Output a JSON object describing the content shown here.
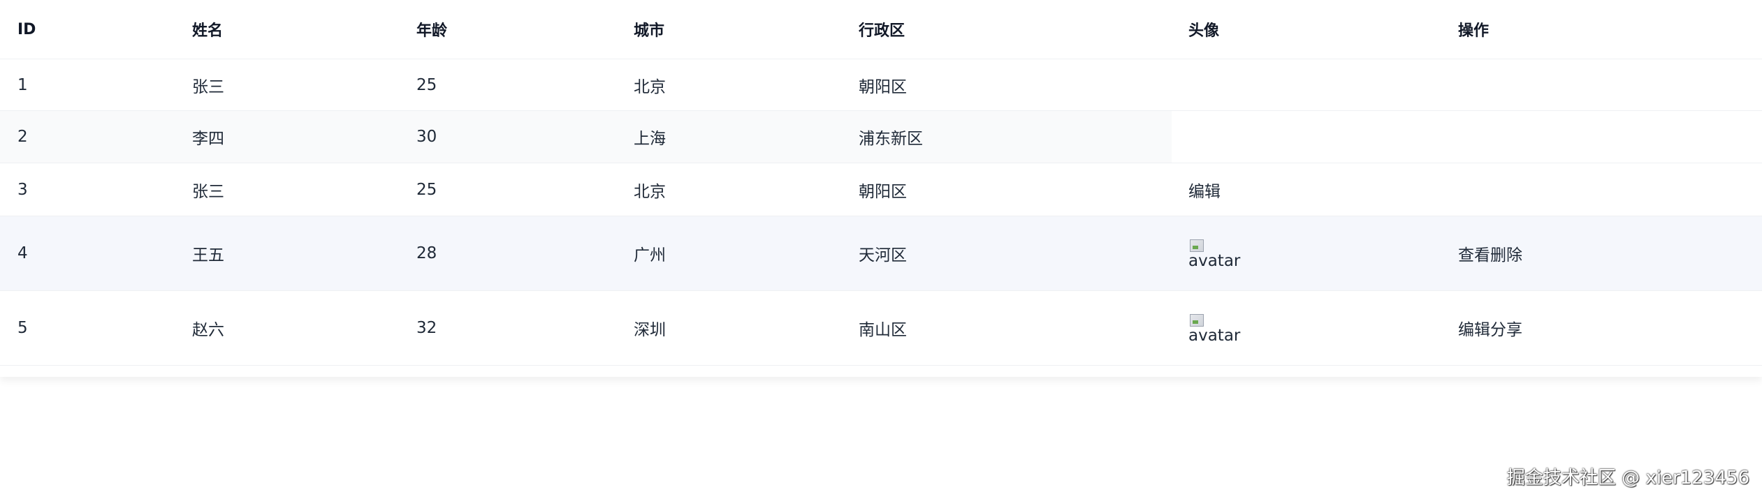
{
  "table": {
    "headers": [
      "ID",
      "姓名",
      "年龄",
      "城市",
      "行政区",
      "头像",
      "操作"
    ],
    "rows": [
      {
        "id": "1",
        "name": "张三",
        "age": "25",
        "city": "北京",
        "district": "朝阳区",
        "avatar": "",
        "actions": ""
      },
      {
        "id": "2",
        "name": "李四",
        "age": "30",
        "city": "上海",
        "district": "浦东新区",
        "avatar": "",
        "actions": ""
      },
      {
        "id": "3",
        "name": "张三",
        "age": "25",
        "city": "北京",
        "district": "朝阳区",
        "avatar": "编辑",
        "actions": ""
      },
      {
        "id": "4",
        "name": "王五",
        "age": "28",
        "city": "广州",
        "district": "天河区",
        "avatar_alt": "avatar",
        "actions": "查看删除"
      },
      {
        "id": "5",
        "name": "赵六",
        "age": "32",
        "city": "深圳",
        "district": "南山区",
        "avatar_alt": "avatar",
        "actions": "编辑分享"
      }
    ]
  },
  "watermark": "掘金技术社区 @ xier123456",
  "colors": {
    "header_text": "#111827",
    "row_text": "#1f2937",
    "stripe": "#f9fafb",
    "hover_row": "#f5f7fc",
    "border": "#eef0f3"
  }
}
